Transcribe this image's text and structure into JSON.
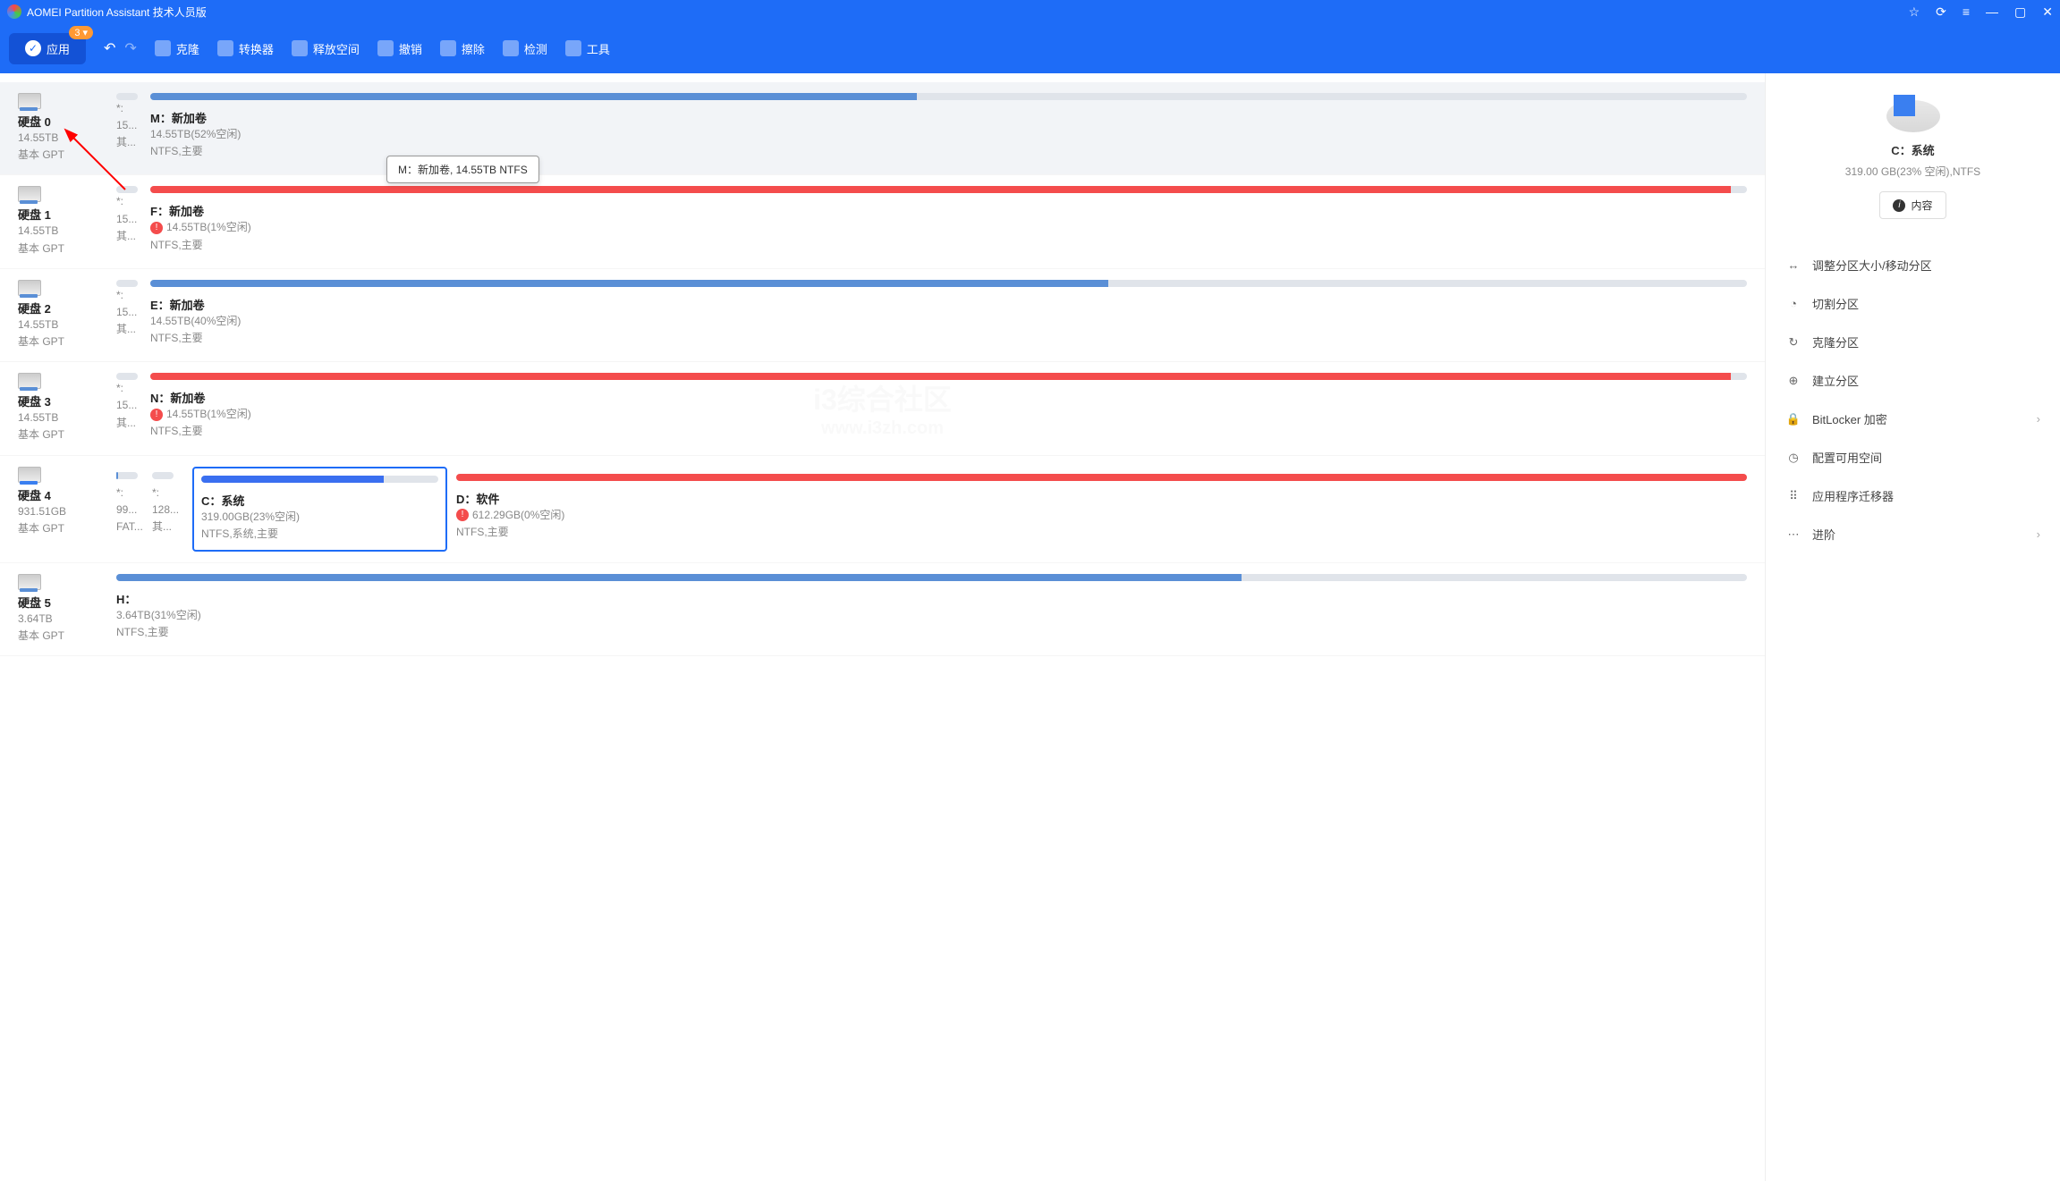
{
  "titlebar": {
    "title": "AOMEI Partition Assistant 技术人员版"
  },
  "toolbar": {
    "apply_label": "应用",
    "badge": "3 ▾",
    "items": [
      {
        "label": "克隆",
        "icon": "clone-icon"
      },
      {
        "label": "转换器",
        "icon": "convert-icon"
      },
      {
        "label": "释放空间",
        "icon": "freespace-icon"
      },
      {
        "label": "撤销",
        "icon": "undo-icon"
      },
      {
        "label": "擦除",
        "icon": "wipe-icon"
      },
      {
        "label": "检测",
        "icon": "check-icon"
      },
      {
        "label": "工具",
        "icon": "tools-icon"
      }
    ]
  },
  "tooltip": "M：新加卷, 14.55TB NTFS",
  "disks": [
    {
      "name": "硬盘 0",
      "size": "14.55TB",
      "type": "基本 GPT",
      "col1": {
        "l1": "*:",
        "l2": "15...",
        "l3": "其..."
      },
      "part": {
        "label": "M：新加卷",
        "sub1": "14.55TB(52%空闲)",
        "sub2": "NTFS,主要",
        "fill": 48,
        "color": "blue"
      }
    },
    {
      "name": "硬盘 1",
      "size": "14.55TB",
      "type": "基本 GPT",
      "col1": {
        "l1": "*:",
        "l2": "15...",
        "l3": "其..."
      },
      "part": {
        "label": "F：新加卷",
        "sub1": "14.55TB(1%空闲)",
        "sub2": "NTFS,主要",
        "fill": 99,
        "color": "red",
        "warn": true
      }
    },
    {
      "name": "硬盘 2",
      "size": "14.55TB",
      "type": "基本 GPT",
      "col1": {
        "l1": "*:",
        "l2": "15...",
        "l3": "其..."
      },
      "part": {
        "label": "E：新加卷",
        "sub1": "14.55TB(40%空闲)",
        "sub2": "NTFS,主要",
        "fill": 60,
        "color": "blue"
      }
    },
    {
      "name": "硬盘 3",
      "size": "14.55TB",
      "type": "基本 GPT",
      "col1": {
        "l1": "*:",
        "l2": "15...",
        "l3": "其..."
      },
      "part": {
        "label": "N：新加卷",
        "sub1": "14.55TB(1%空闲)",
        "sub2": "NTFS,主要",
        "fill": 99,
        "color": "red",
        "warn": true
      }
    }
  ],
  "disk4": {
    "name": "硬盘 4",
    "size": "931.51GB",
    "type": "基本 GPT",
    "col1": {
      "l1": "*:",
      "l2": "99...",
      "l3": "FAT..."
    },
    "col2": {
      "l1": "*:",
      "l2": "128...",
      "l3": "其..."
    },
    "partC": {
      "label": "C：系统",
      "sub1": "319.00GB(23%空闲)",
      "sub2": "NTFS,系统,主要",
      "fill": 77,
      "color": "#3a6ff0"
    },
    "partD": {
      "label": "D：软件",
      "sub1": "612.29GB(0%空闲)",
      "sub2": "NTFS,主要",
      "fill": 100,
      "color": "#f44c4c",
      "warn": true
    }
  },
  "disk5": {
    "name": "硬盘 5",
    "size": "3.64TB",
    "type": "基本 GPT",
    "part": {
      "label": "H：",
      "sub1": "3.64TB(31%空闲)",
      "sub2": "NTFS,主要",
      "fill": 69,
      "color": "blue"
    }
  },
  "sidebar": {
    "title": "C：系统",
    "sub": "319.00 GB(23% 空闲),NTFS",
    "content_btn": "内容",
    "menu": [
      {
        "label": "调整分区大小/移动分区",
        "icon": "↔"
      },
      {
        "label": "切割分区",
        "icon": "◔"
      },
      {
        "label": "克隆分区",
        "icon": "↻"
      },
      {
        "label": "建立分区",
        "icon": "⊕"
      },
      {
        "label": "BitLocker 加密",
        "icon": "🔒",
        "chev": true
      },
      {
        "label": "配置可用空间",
        "icon": "◷"
      },
      {
        "label": "应用程序迁移器",
        "icon": "⠿"
      },
      {
        "label": "进阶",
        "icon": "⋯",
        "chev": true
      }
    ]
  },
  "watermark": {
    "l1": "i3综合社区",
    "l2": "www.i3zh.com"
  }
}
